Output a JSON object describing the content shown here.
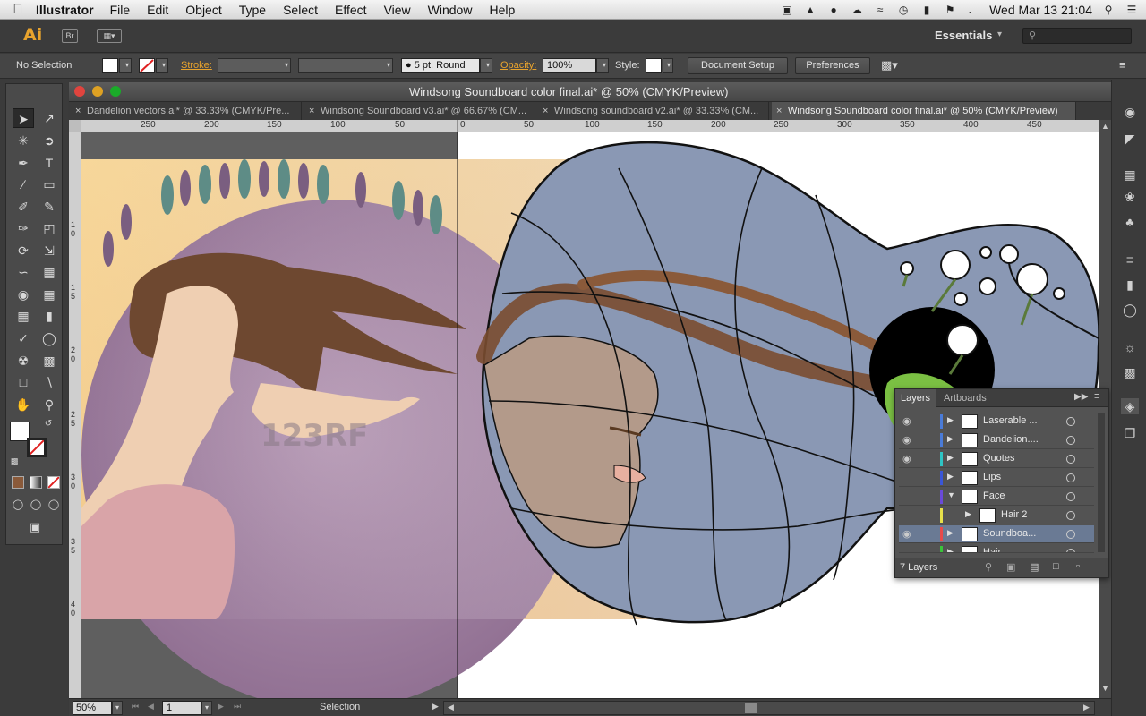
{
  "menubar": {
    "app": "Illustrator",
    "items": [
      "File",
      "Edit",
      "Object",
      "Type",
      "Select",
      "Effect",
      "View",
      "Window",
      "Help"
    ],
    "clock": "Wed Mar 13  21:04"
  },
  "appbar": {
    "logo": "Ai",
    "bridge_label": "Br",
    "workspace": "Essentials"
  },
  "control": {
    "selection": "No Selection",
    "stroke_label": "Stroke:",
    "brush": "5 pt. Round",
    "opacity_label": "Opacity:",
    "opacity_value": "100%",
    "style_label": "Style:",
    "document_setup": "Document Setup",
    "preferences": "Preferences"
  },
  "document": {
    "title": "Windsong Soundboard color final.ai* @ 50% (CMYK/Preview)",
    "tabs": [
      {
        "label": "Dandelion vectors.ai* @ 33.33% (CMYK/Pre..."
      },
      {
        "label": "Windsong Soundboard v3.ai* @ 66.67% (CM..."
      },
      {
        "label": "Windsong soundboard v2.ai* @ 33.33% (CM..."
      },
      {
        "label": "Windsong Soundboard color final.ai* @ 50% (CMYK/Preview)"
      }
    ],
    "ruler_top": [
      "250",
      "200",
      "150",
      "100",
      "50",
      "0",
      "50",
      "100",
      "150",
      "200",
      "250",
      "300",
      "350",
      "400",
      "450"
    ],
    "ruler_left": [
      "1",
      "0",
      "1",
      "5",
      "2",
      "0",
      "2",
      "5",
      "3",
      "0",
      "3",
      "5",
      "4",
      "0"
    ],
    "watermark": "123RF"
  },
  "status": {
    "zoom": "50%",
    "page": "1",
    "tool": "Selection"
  },
  "layers": {
    "tabs": [
      "Layers",
      "Artboards"
    ],
    "rows": [
      {
        "name": "Laserable ...",
        "visible": true,
        "color": "#4a7bd8",
        "expanded": false
      },
      {
        "name": "Dandelion....",
        "visible": true,
        "color": "#4a7bd8",
        "expanded": false
      },
      {
        "name": "Quotes",
        "visible": true,
        "color": "#2ec4c4",
        "expanded": false
      },
      {
        "name": "Lips",
        "visible": false,
        "color": "#3a56d8",
        "expanded": false
      },
      {
        "name": "Face",
        "visible": false,
        "color": "#6a4ad8",
        "expanded": true
      },
      {
        "name": "Hair 2",
        "visible": false,
        "color": "#e6e04a",
        "expanded": false
      },
      {
        "name": "Soundboa...",
        "visible": true,
        "color": "#e84a4a",
        "expanded": false
      },
      {
        "name": "Hair",
        "visible": false,
        "color": "#3ac43a",
        "expanded": false
      }
    ],
    "count": "7 Layers"
  }
}
